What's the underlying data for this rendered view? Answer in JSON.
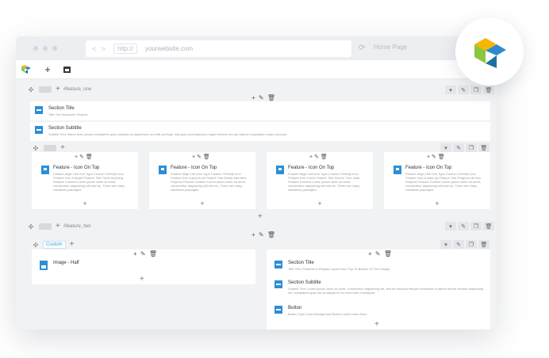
{
  "browser": {
    "url_arrows": "< >",
    "protocol": "http://",
    "url": "yourwebsite.com",
    "reload_icon": "⟳",
    "home_label": "Home Page"
  },
  "toolbar": {
    "add_label": "+",
    "layout_icon": "layout-icon"
  },
  "rows": [
    {
      "label": "#feature_one",
      "elements": [
        {
          "title": "Section Title",
          "sub": "Title Text Awesome Feature"
        },
        {
          "title": "Section Subtitle",
          "sub": "Subtitle Text: Nemo enim ipsam voluptatem quia voluptas sit aspernatur aut odit aut fugit, sed quia consequuntur magni dolores eos qui ratione voluptatem sequi nesciunt."
        }
      ],
      "features": [
        {
          "title": "Feature - Icon On Top",
          "body": "Feature Align Left Icon Type Custom Themify Icon Feature Icon ti-target Feature Title Track Anything Feature Content Lorem ipsum dolor sit amet, consectetur adipisicing elit sed do, There are many variations passages."
        },
        {
          "title": "Feature - Icon On Top",
          "body": "Feature Align Left Icon Type Custom Themify Icon Feature Icon ti-pencil-alt Feature Title Easily Add New Projects Feature Content Lorem ipsum dolor sit amet, consectetur adipisicing elit sed do, There are many variations passages."
        },
        {
          "title": "Feature - Icon On Top",
          "body": "Feature Align Left Icon Type Custom Themify Icon Feature Icon ti-lock Feature Title Secure Your Data Feature Content Lorem ipsum dolor sit amet, consectetur adipisicing elit sed do, There are many variations passages."
        },
        {
          "title": "Feature - Icon On Top",
          "body": "Feature Align Left Icon Type Custom Themify Icon Feature Icon ti-stats-up Feature Title Progress Across Projects Feature Content Lorem ipsum dolor sit amet, consectetur adipisicing elit sed do, There are many variations passages."
        }
      ]
    },
    {
      "label": "#feature_two",
      "custom_tag": "Custom",
      "left_element": {
        "title": "Image - Half"
      },
      "right_elements": [
        {
          "title": "Section Title",
          "sub": "Title Text: Powerful & Elegant Layout from Top To Bottom Of The Design"
        },
        {
          "title": "Section Subtitle",
          "sub": "Subtitle Text: Lorem ipsum dolor sit amet, consectetur adipisicing elit, sed do eiusmod tempor incididunt ut labore dolore veniam adipisicing elit, voluptatem quia nisi ut aliquip ex ea commodo consequat."
        },
        {
          "title": "Button",
          "sub": "Button Type Color Background Button Label Learn More"
        }
      ]
    }
  ],
  "controls": {
    "plus": "+",
    "edit": "✎",
    "trash": "🗑",
    "center": "+ ✎ 🗑",
    "right": [
      "▾",
      "✎",
      "❐",
      "🗑"
    ],
    "handle": "✣"
  },
  "colors": {
    "accent": "#2c8fd6",
    "logo_yellow": "#f6b600",
    "logo_blue": "#2d8ad1",
    "logo_green": "#8cc63f",
    "logo_teal": "#1f6f9f"
  }
}
